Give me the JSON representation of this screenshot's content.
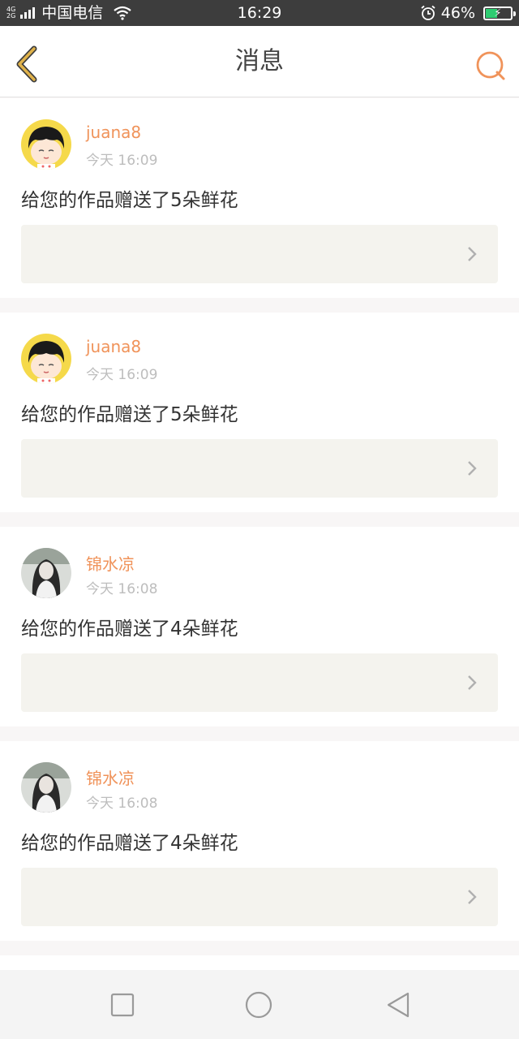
{
  "status_bar": {
    "network_top": "4G",
    "network_bottom": "2G",
    "carrier": "中国电信",
    "time": "16:29",
    "battery": "46%",
    "battery_level": 0.46
  },
  "header": {
    "title": "消息"
  },
  "messages": [
    {
      "username": "juana8",
      "time": "今天 16:09",
      "text": "给您的作品赠送了5朵鲜花"
    },
    {
      "username": "juana8",
      "time": "今天 16:09",
      "text": "给您的作品赠送了5朵鲜花"
    },
    {
      "username": "锦水凉",
      "time": "今天 16:08",
      "text": "给您的作品赠送了4朵鲜花"
    },
    {
      "username": "锦水凉",
      "time": "今天 16:08",
      "text": "给您的作品赠送了4朵鲜花"
    }
  ],
  "colors": {
    "accent": "#f0935a",
    "status_bar": "#3d3d3d",
    "back_icon": "#e0b24a",
    "work_box": "#f4f3ee"
  }
}
